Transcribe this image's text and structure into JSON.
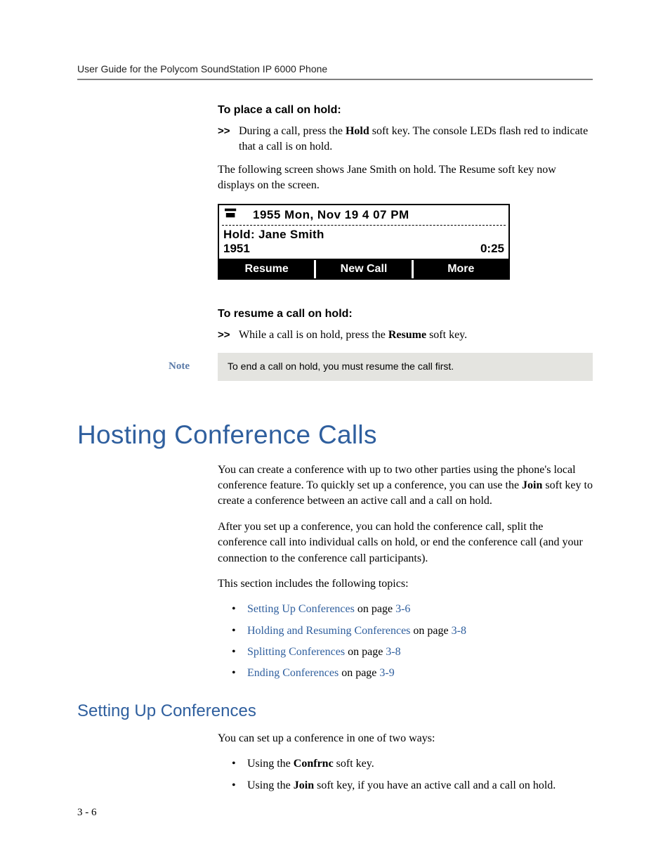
{
  "header": {
    "running": "User Guide for the Polycom SoundStation IP 6000 Phone"
  },
  "sec1": {
    "title": "To place a call on hold:",
    "arrow": ">>",
    "step_pre": "During a call, press the ",
    "step_bold": "Hold",
    "step_post": " soft key. The console LEDs flash red to indicate that a call is on hold.",
    "para": "The following screen shows Jane Smith on hold. The Resume soft key now displays on the screen."
  },
  "lcd": {
    "line1": "1955  Mon, Nov 19   4 07 PM",
    "line2": "Hold: Jane Smith",
    "line3_left": "1951",
    "line3_right": "0:25",
    "soft": [
      "Resume",
      "New Call",
      "More"
    ]
  },
  "sec2": {
    "title": "To resume a call on hold:",
    "arrow": ">>",
    "step_pre": "While a call is on hold, press the ",
    "step_bold": "Resume",
    "step_post": " soft key."
  },
  "note": {
    "label": "Note",
    "text": "To end a call on hold, you must resume the call first."
  },
  "h1": "Hosting Conference Calls",
  "conf": {
    "p1_pre": "You can create a conference with up to two other parties using the phone's local conference feature. To quickly set up a conference, you can use the ",
    "p1_bold": "Join",
    "p1_post": " soft key to create a conference between an active call and a call on hold.",
    "p2": "After you set up a conference, you can hold the conference call, split the conference call into individual calls on hold, or end the conference call (and your connection to the conference call participants).",
    "p3": "This section includes the following topics:"
  },
  "topics": [
    {
      "link": "Setting Up Conferences",
      "mid": " on page ",
      "page": "3-6"
    },
    {
      "link": "Holding and Resuming Conferences",
      "mid": " on page ",
      "page": "3-8"
    },
    {
      "link": "Splitting Conferences",
      "mid": " on page ",
      "page": "3-8"
    },
    {
      "link": "Ending Conferences",
      "mid": " on page ",
      "page": "3-9"
    }
  ],
  "h2": "Setting Up Conferences",
  "setup": {
    "p1": "You can set up a conference in one of two ways:"
  },
  "ways": [
    {
      "pre": "Using the ",
      "bold": "Confrnc",
      "post": " soft key."
    },
    {
      "pre": "Using the ",
      "bold": "Join",
      "post": " soft key, if you have an active call and a call on hold."
    }
  ],
  "footer": {
    "pagenum": "3 - 6"
  }
}
